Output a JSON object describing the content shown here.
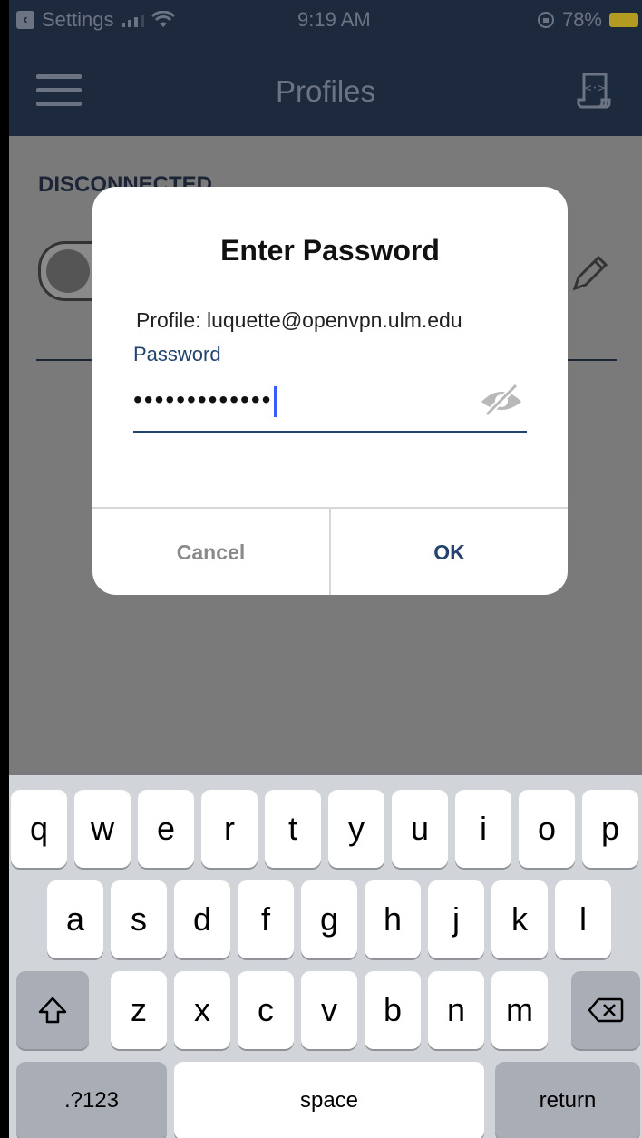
{
  "status_bar": {
    "back_label": "Settings",
    "time": "9:19 AM",
    "battery": "78%"
  },
  "header": {
    "title": "Profiles"
  },
  "background": {
    "status": "DISCONNECTED"
  },
  "dialog": {
    "title": "Enter Password",
    "profile": "Profile: luquette@openvpn.ulm.edu",
    "password_label": "Password",
    "password_masked": "•••••••••••••",
    "cancel_label": "Cancel",
    "ok_label": "OK"
  },
  "keyboard": {
    "row1": [
      "q",
      "w",
      "e",
      "r",
      "t",
      "y",
      "u",
      "i",
      "o",
      "p"
    ],
    "row2": [
      "a",
      "s",
      "d",
      "f",
      "g",
      "h",
      "j",
      "k",
      "l"
    ],
    "row3": [
      "z",
      "x",
      "c",
      "v",
      "b",
      "n",
      "m"
    ],
    "numbers_label": ".?123",
    "space_label": "space",
    "return_label": "return"
  },
  "colors": {
    "navy": "#1d2a3e",
    "accent": "#23426d"
  }
}
